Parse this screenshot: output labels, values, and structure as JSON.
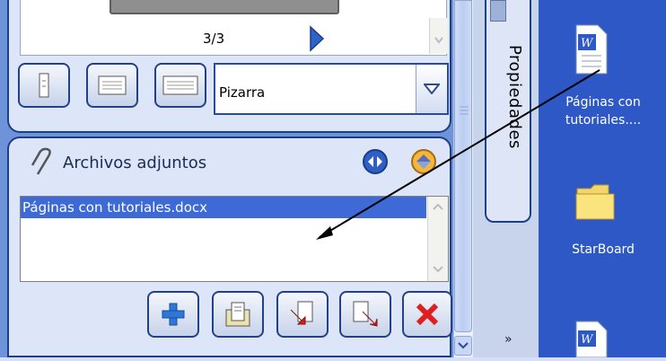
{
  "preview": {
    "page_counter": "3/3"
  },
  "view": {
    "select_value": "Pizarra"
  },
  "attachments": {
    "title": "Archivos adjuntos",
    "items": [
      "Páginas con tutoriales.docx"
    ]
  },
  "sidebar": {
    "tab_label": "Propiedades"
  },
  "desktop": {
    "icons": [
      {
        "label_line1": "Páginas con",
        "label_line2": "tutoriales...."
      },
      {
        "label_line1": "StarBoard",
        "label_line2": ""
      }
    ]
  },
  "colors": {
    "panel": "#6f93d8",
    "desktop": "#2d58c6",
    "selection": "#3d6ad6"
  }
}
